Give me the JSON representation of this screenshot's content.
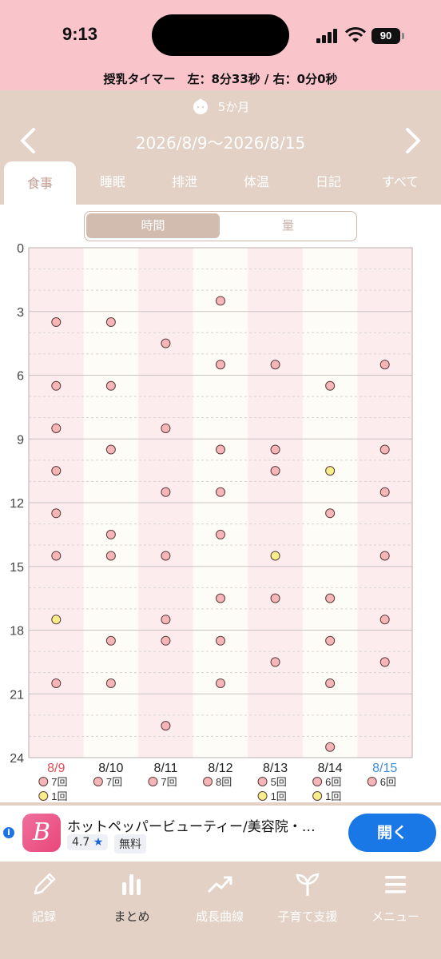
{
  "status": {
    "time": "9:13",
    "battery": "90"
  },
  "timer_text": "授乳タイマー　左：8分33秒 / 右：0分0秒",
  "age": "5か月",
  "date_range": "2026/8/9〜2026/8/15",
  "tabs": [
    {
      "label": "食事",
      "active": true
    },
    {
      "label": "睡眠"
    },
    {
      "label": "排泄"
    },
    {
      "label": "体温"
    },
    {
      "label": "日記"
    },
    {
      "label": "すべて"
    }
  ],
  "segment": {
    "selected": "時間",
    "other": "量"
  },
  "colors": {
    "pink_dot": "#f6b6b7",
    "yellow_dot": "#f7ee8a",
    "saturday": "#e64c56",
    "sunday": "#3c8fe0",
    "accent": "#c39e92"
  },
  "chart_data": {
    "type": "scatter",
    "y_axis": {
      "ticks": [
        "0",
        "3",
        "6",
        "9",
        "12",
        "15",
        "18",
        "21",
        "24"
      ],
      "ylim": [
        0,
        24
      ],
      "inverted": true
    },
    "days": [
      {
        "label": "8/9",
        "pink": [
          3.5,
          6.5,
          8.5,
          10.5,
          12.5,
          14.5,
          20.5
        ],
        "yellow": [
          17.5
        ],
        "pink_count": "7回",
        "yellow_count": "1回"
      },
      {
        "label": "8/10",
        "pink": [
          3.5,
          6.5,
          9.5,
          13.5,
          14.5,
          18.5,
          20.5
        ],
        "yellow": [],
        "pink_count": "7回",
        "yellow_count": ""
      },
      {
        "label": "8/11",
        "pink": [
          4.5,
          8.5,
          11.5,
          14.5,
          17.5,
          18.5,
          22.5
        ],
        "yellow": [],
        "pink_count": "7回",
        "yellow_count": ""
      },
      {
        "label": "8/12",
        "pink": [
          2.5,
          5.5,
          9.5,
          11.5,
          13.5,
          16.5,
          18.5,
          20.5
        ],
        "yellow": [],
        "pink_count": "8回",
        "yellow_count": ""
      },
      {
        "label": "8/13",
        "pink": [
          5.5,
          9.5,
          10.5,
          16.5,
          19.5
        ],
        "yellow": [
          14.5
        ],
        "pink_count": "5回",
        "yellow_count": "1回"
      },
      {
        "label": "8/14",
        "pink": [
          6.5,
          12.5,
          16.5,
          18.5,
          20.5,
          23.5
        ],
        "yellow": [
          10.5
        ],
        "pink_count": "6回",
        "yellow_count": "1回"
      },
      {
        "label": "8/15",
        "pink": [
          5.5,
          9.5,
          11.5,
          14.5,
          17.5,
          19.5
        ],
        "yellow": [],
        "pink_count": "6回",
        "yellow_count": ""
      }
    ]
  },
  "ad": {
    "logo": "B",
    "title": "ホットペッパービューティー/美容院・…",
    "rating": "4.7",
    "price": "無料",
    "cta": "開く"
  },
  "bottom_nav": [
    {
      "label": "記録",
      "icon": "pencil-icon"
    },
    {
      "label": "まとめ",
      "icon": "bar-chart-icon",
      "active": true
    },
    {
      "label": "成長曲線",
      "icon": "trend-up-icon"
    },
    {
      "label": "子育て支援",
      "icon": "sprout-icon"
    },
    {
      "label": "メニュー",
      "icon": "menu-icon"
    }
  ]
}
